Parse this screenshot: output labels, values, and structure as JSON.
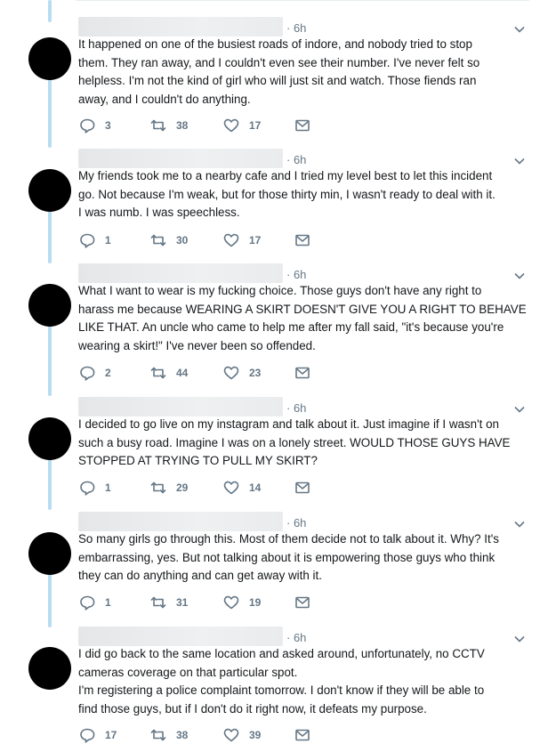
{
  "tweets": [
    {
      "time": "· 6h",
      "lines": [
        "It happened on one of the busiest roads of indore, and nobody tried to stop",
        "them. They ran away, and I couldn't even see their number. I've never felt so",
        "helpless. I'm not the kind of girl who will just sit and watch. Those fiends ran",
        "away, and I couldn't do anything."
      ],
      "replies": "3",
      "retweets": "38",
      "likes": "17"
    },
    {
      "time": "· 6h",
      "lines": [
        "My friends took me to a nearby cafe and I tried my level best to let this incident",
        "go. Not because I'm weak, but  for those thirty min, I wasn't ready to deal with it.",
        "I was numb. I was speechless."
      ],
      "replies": "1",
      "retweets": "30",
      "likes": "17"
    },
    {
      "time": "· 6h",
      "lines": [
        "What I want to wear is my fucking choice. Those guys don't have any right to",
        "harass me because WEARING A SKIRT DOESN'T GIVE YOU A RIGHT TO BEHAVE",
        "LIKE THAT. An uncle who came to help me after my fall said, \"it's because you're",
        "wearing a skirt!\" I've never been so offended."
      ],
      "replies": "2",
      "retweets": "44",
      "likes": "23"
    },
    {
      "time": "· 6h",
      "lines": [
        "I decided to go live on my instagram and talk about it. Just imagine if I wasn't on",
        "such a busy road. Imagine I was on a lonely street. WOULD THOSE GUYS HAVE",
        "STOPPED AT TRYING TO PULL MY SKIRT?"
      ],
      "replies": "1",
      "retweets": "29",
      "likes": "14"
    },
    {
      "time": "· 6h",
      "lines": [
        "So many girls go through this. Most of them decide not to talk about it. Why? It's",
        "embarrassing, yes. But not talking about it is empowering those guys who think",
        "they can do anything and can get away with it."
      ],
      "replies": "1",
      "retweets": "31",
      "likes": "19"
    },
    {
      "time": "· 6h",
      "lines": [
        "I did go back to the same location and asked around, unfortunately, no CCTV",
        "cameras coverage on that particular spot.",
        "I'm registering a police complaint tomorrow. I don't know if they will be able to",
        "find those guys, but if I don't do it right now, it defeats my purpose."
      ],
      "replies": "17",
      "retweets": "38",
      "likes": "39"
    }
  ],
  "icons": {
    "reply": "reply-icon",
    "retweet": "retweet-icon",
    "like": "heart-icon",
    "dm": "direct-message-icon",
    "caret": "chevron-down-icon"
  },
  "colors": {
    "thread_line": "#b8dcf2",
    "icon": "#657786",
    "text": "#14171a",
    "avatar": "#000000"
  }
}
